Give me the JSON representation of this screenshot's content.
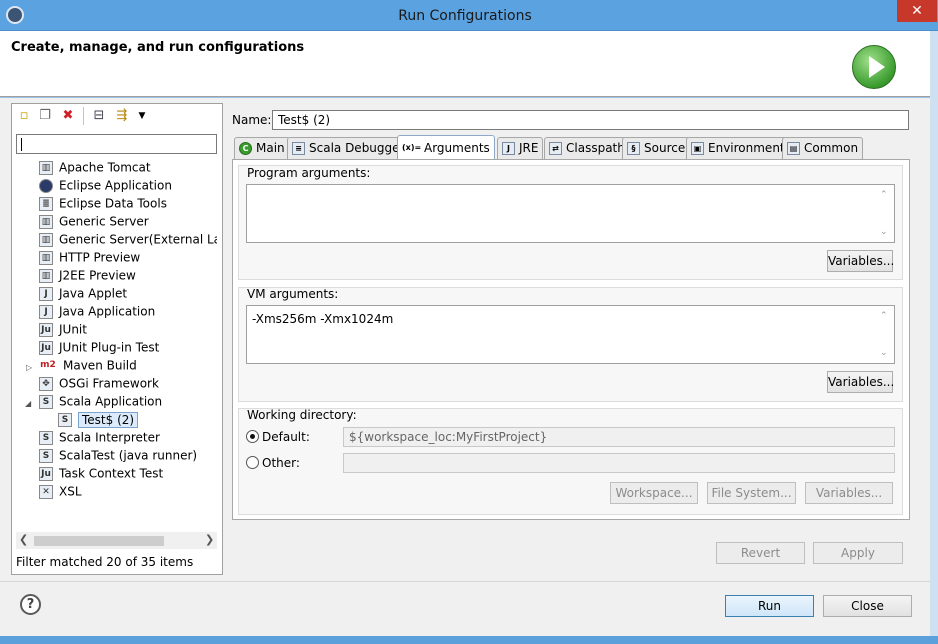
{
  "window": {
    "title": "Run Configurations",
    "close_glyph": "✕"
  },
  "header": {
    "text": "Create, manage, and run configurations"
  },
  "left": {
    "toolbar_icons": [
      "new-launch-config-icon",
      "duplicate-icon",
      "delete-icon",
      "collapse-all-icon",
      "filter-icon",
      "dropdown-icon"
    ],
    "tree": [
      {
        "label": "Apache Tomcat",
        "icon": "server-icon"
      },
      {
        "label": "Eclipse Application",
        "icon": "eclipse-icon"
      },
      {
        "label": "Eclipse Data Tools",
        "icon": "database-icon"
      },
      {
        "label": "Generic Server",
        "icon": "server-icon"
      },
      {
        "label": "Generic Server(External Launch",
        "icon": "server-icon"
      },
      {
        "label": "HTTP Preview",
        "icon": "server-icon"
      },
      {
        "label": "J2EE Preview",
        "icon": "server-icon"
      },
      {
        "label": "Java Applet",
        "icon": "java-applet-icon"
      },
      {
        "label": "Java Application",
        "icon": "java-app-icon"
      },
      {
        "label": "JUnit",
        "icon": "junit-icon"
      },
      {
        "label": "JUnit Plug-in Test",
        "icon": "junit-plugin-icon"
      },
      {
        "label": "Maven Build",
        "icon": "maven-icon"
      },
      {
        "label": "OSGi Framework",
        "icon": "osgi-icon"
      },
      {
        "label": "Scala Application",
        "icon": "scala-icon"
      },
      {
        "label": "Test$ (2)",
        "icon": "scala-icon"
      },
      {
        "label": "Scala Interpreter",
        "icon": "scala-icon"
      },
      {
        "label": "ScalaTest (java runner)",
        "icon": "scala-icon"
      },
      {
        "label": "Task Context Test",
        "icon": "junit-icon"
      },
      {
        "label": "XSL",
        "icon": "xsl-icon"
      }
    ],
    "filter_status": "Filter matched 20 of 35 items"
  },
  "right": {
    "name_label": "Name:",
    "name_value": "Test$ (2)",
    "tabs": [
      {
        "label": "Main",
        "icon": "main-icon"
      },
      {
        "label": "Scala Debugger",
        "icon": "debugger-icon"
      },
      {
        "label": "Arguments",
        "icon": "arguments-icon"
      },
      {
        "label": "JRE",
        "icon": "jre-icon"
      },
      {
        "label": "Classpath",
        "icon": "classpath-icon"
      },
      {
        "label": "Source",
        "icon": "source-icon"
      },
      {
        "label": "Environment",
        "icon": "environment-icon"
      },
      {
        "label": "Common",
        "icon": "common-icon"
      }
    ],
    "program_args_label": "Program arguments:",
    "program_args_value": "",
    "variables_label": "Variables...",
    "vm_args_label": "VM arguments:",
    "vm_args_value": "-Xms256m -Xmx1024m",
    "working_dir_label": "Working directory:",
    "default_label": "Default:",
    "default_value": "${workspace_loc:MyFirstProject}",
    "other_label": "Other:",
    "other_value": "",
    "workspace_btn": "Workspace...",
    "filesystem_btn": "File System...",
    "variables_btn3": "Variables...",
    "revert_btn": "Revert",
    "apply_btn": "Apply"
  },
  "footer": {
    "run_btn": "Run",
    "close_btn": "Close",
    "help_glyph": "?"
  }
}
